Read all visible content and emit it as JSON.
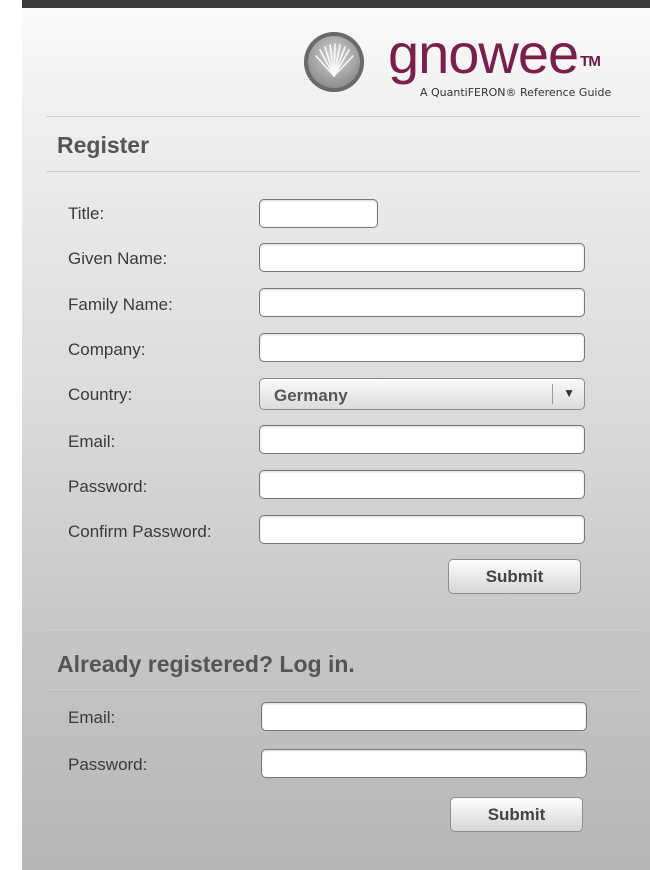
{
  "brand": {
    "name": "gnowee",
    "trademark": "TM",
    "tagline": "A QuantiFERON® Reference Guide"
  },
  "register": {
    "title": "Register",
    "fields": [
      {
        "label": "Title:",
        "value": ""
      },
      {
        "label": "Given Name:",
        "value": ""
      },
      {
        "label": "Family Name:",
        "value": ""
      },
      {
        "label": "Company:",
        "value": ""
      },
      {
        "label": "Country:",
        "value": "Germany"
      },
      {
        "label": "Email:",
        "value": ""
      },
      {
        "label": "Password:",
        "value": ""
      },
      {
        "label": "Confirm Password:",
        "value": ""
      }
    ],
    "submit_label": "Submit"
  },
  "login": {
    "title": "Already registered? Log in.",
    "fields": [
      {
        "label": "Email:",
        "value": ""
      },
      {
        "label": "Password:",
        "value": ""
      }
    ],
    "submit_label": "Submit"
  },
  "icons": {
    "logo": "sunburst-logo-icon",
    "dropdown": "triangle-down-icon"
  },
  "colors": {
    "brand": "#7a1f4a",
    "top_bar": "#3b3b3b"
  }
}
